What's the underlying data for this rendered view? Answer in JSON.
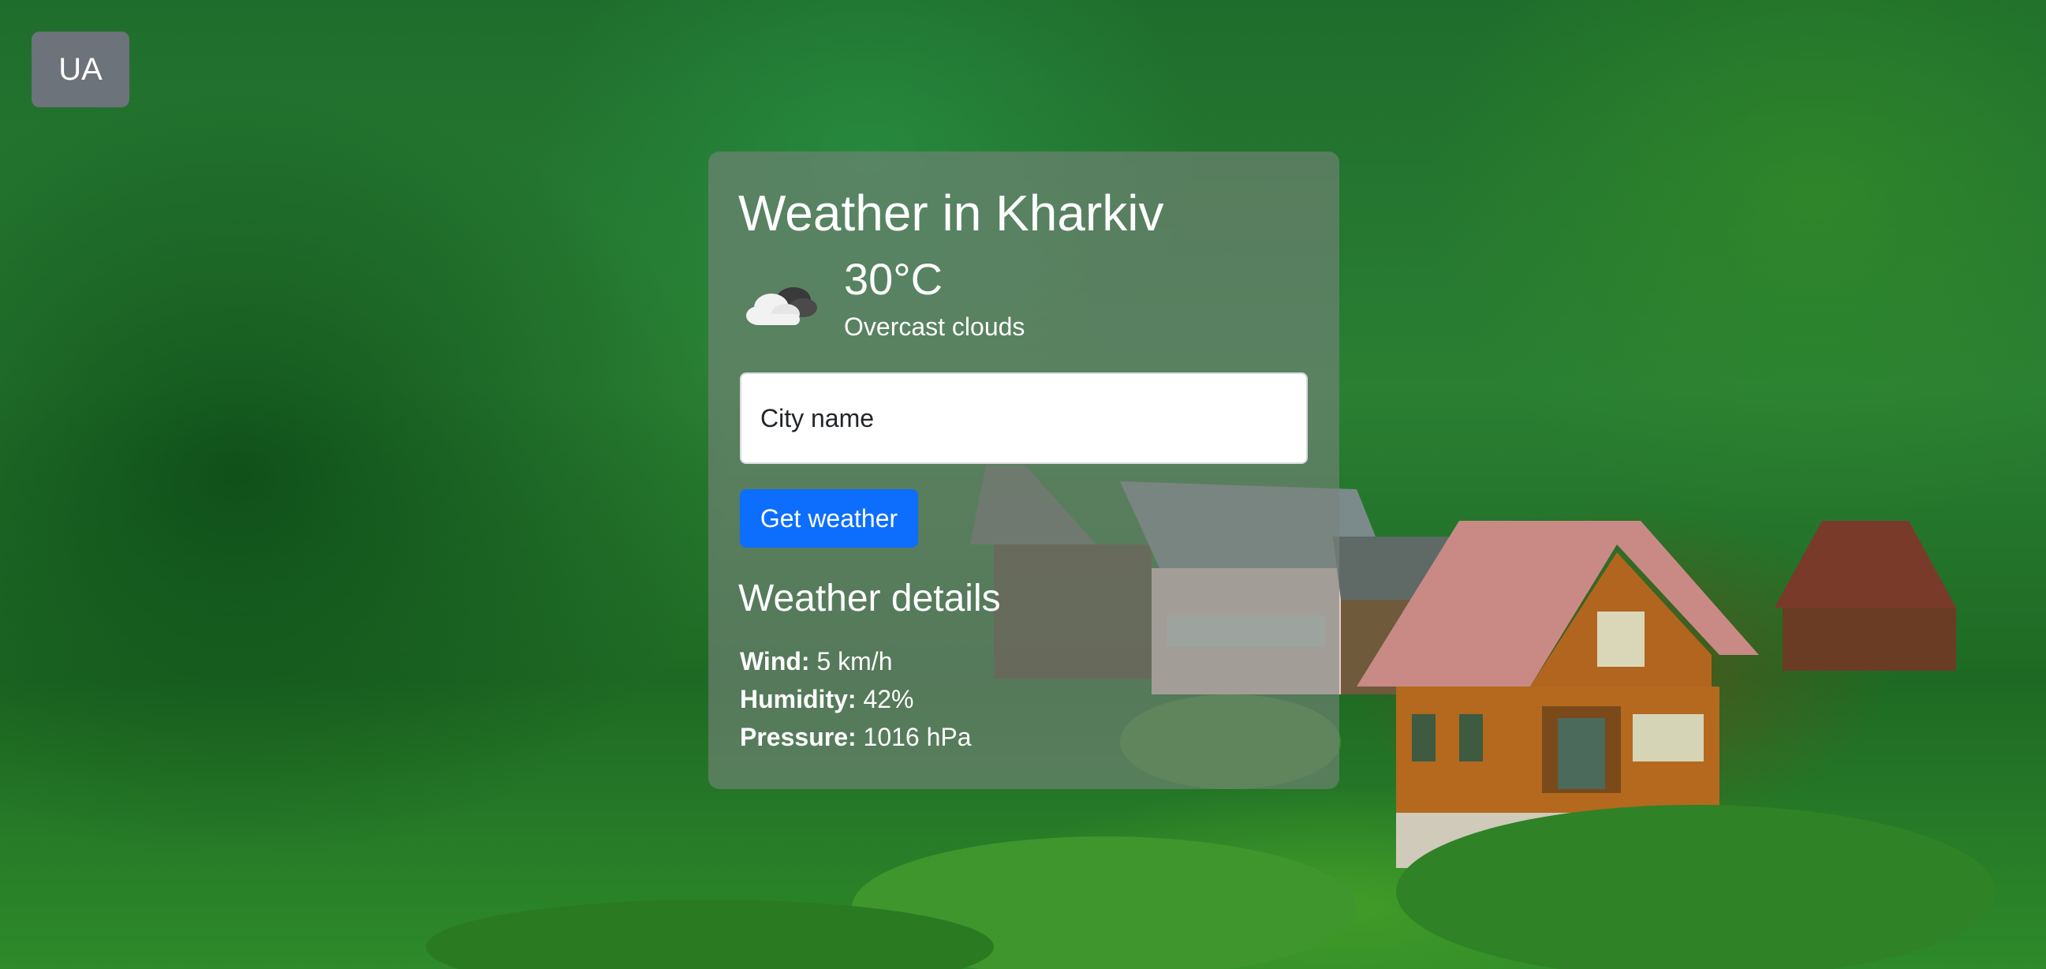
{
  "language_button": "UA",
  "weather": {
    "title": "Weather in Kharkiv",
    "icon": "cloud-icon",
    "temperature": "30°C",
    "description": "Overcast clouds"
  },
  "search": {
    "placeholder": "City name",
    "value": ""
  },
  "get_weather_label": "Get weather",
  "details": {
    "title": "Weather details",
    "wind_label": "Wind:",
    "wind_value": "5 km/h",
    "humidity_label": "Humidity:",
    "humidity_value": "42%",
    "pressure_label": "Pressure:",
    "pressure_value": "1016 hPa"
  },
  "colors": {
    "button_primary": "#0d6efd",
    "language_button": "#6c737a"
  }
}
